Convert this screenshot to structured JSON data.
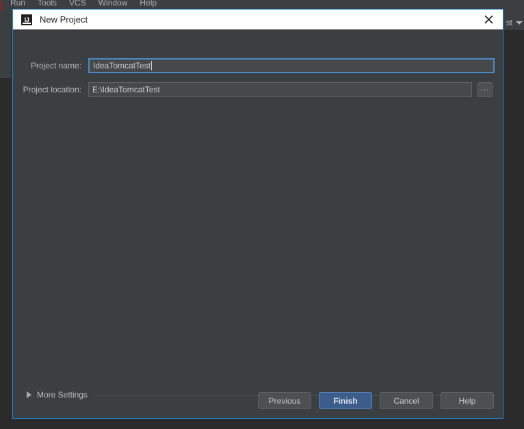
{
  "ide": {
    "menu_items": [
      "Run",
      "Tools",
      "VCS",
      "Window",
      "Help"
    ],
    "toolbar_right_label": "st"
  },
  "dialog": {
    "title": "New Project",
    "title_icon": "intellij-idea-icon",
    "title_icon_text": "IJ",
    "close_icon": "close-icon",
    "fields": {
      "project_name": {
        "label": "Project name:",
        "value": "IdeaTomcatTest",
        "placeholder": ""
      },
      "project_location": {
        "label": "Project location:",
        "value": "E:\\IdeaTomcatTest",
        "placeholder": "",
        "browse_label": "..."
      }
    },
    "more_settings": {
      "label": "More Settings",
      "expanded": false,
      "chevron_icon": "chevron-right-icon"
    },
    "buttons": [
      {
        "label": "Previous",
        "primary": false
      },
      {
        "label": "Finish",
        "primary": true
      },
      {
        "label": "Cancel",
        "primary": false
      },
      {
        "label": "Help",
        "primary": false
      }
    ]
  },
  "colors": {
    "dialog_border": "#1f8cdb",
    "dialog_bg": "#3c3f41",
    "titlebar_bg": "#ffffff",
    "primary_button": "#3c5c8c",
    "field_focus_border": "#4a88c7",
    "editor_bg": "#2b2b2b"
  }
}
